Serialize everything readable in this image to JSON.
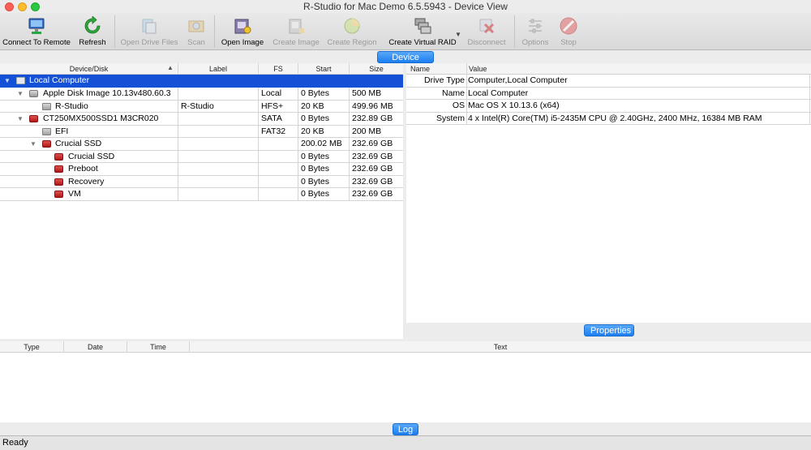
{
  "window": {
    "title": "R-Studio for Mac Demo 6.5.5943 - Device View"
  },
  "toolbar": {
    "connect_remote": "Connect To Remote",
    "refresh": "Refresh",
    "open_drive_files": "Open Drive Files",
    "scan": "Scan",
    "open_image": "Open Image",
    "create_image": "Create Image",
    "create_region": "Create Region",
    "create_virtual_raid": "Create Virtual RAID",
    "disconnect": "Disconnect",
    "options": "Options",
    "stop": "Stop"
  },
  "device_view": {
    "tab_label": "Device view",
    "columns": {
      "device": "Device/Disk",
      "label": "Label",
      "fs": "FS",
      "start": "Start",
      "size": "Size"
    },
    "rows": [
      {
        "name": "Local Computer",
        "label": "",
        "fs": "",
        "start": "",
        "size": ""
      },
      {
        "name": "Apple Disk Image 10.13v480.60.3",
        "label": "",
        "fs": "Local",
        "start": "0 Bytes",
        "size": "500 MB"
      },
      {
        "name": "R-Studio",
        "label": "R-Studio",
        "fs": "HFS+",
        "start": "20 KB",
        "size": "499.96 MB"
      },
      {
        "name": "CT250MX500SSD1 M3CR020",
        "label": "",
        "fs": "SATA",
        "start": "0 Bytes",
        "size": "232.89 GB"
      },
      {
        "name": "EFI",
        "label": "",
        "fs": "FAT32",
        "start": "20 KB",
        "size": "200 MB"
      },
      {
        "name": "Crucial SSD",
        "label": "",
        "fs": "",
        "start": "200.02 MB",
        "size": "232.69 GB"
      },
      {
        "name": "Crucial SSD",
        "label": "",
        "fs": "",
        "start": "0 Bytes",
        "size": "232.69 GB"
      },
      {
        "name": "Preboot",
        "label": "",
        "fs": "",
        "start": "0 Bytes",
        "size": "232.69 GB"
      },
      {
        "name": "Recovery",
        "label": "",
        "fs": "",
        "start": "0 Bytes",
        "size": "232.69 GB"
      },
      {
        "name": "VM",
        "label": "",
        "fs": "",
        "start": "0 Bytes",
        "size": "232.69 GB"
      }
    ]
  },
  "properties": {
    "tab_label": "Properties",
    "columns": {
      "name": "Name",
      "value": "Value"
    },
    "rows": [
      {
        "name": "Drive Type",
        "value": "Computer,Local Computer"
      },
      {
        "name": "Name",
        "value": "Local Computer"
      },
      {
        "name": "OS",
        "value": "Mac OS X 10.13.6 (x64)"
      },
      {
        "name": "System",
        "value": "4 x Intel(R) Core(TM) i5-2435M CPU @ 2.40GHz, 2400 MHz, 16384 MB RAM"
      }
    ]
  },
  "log": {
    "tab_label": "Log",
    "columns": {
      "type": "Type",
      "date": "Date",
      "time": "Time",
      "text": "Text"
    }
  },
  "status": {
    "text": "Ready"
  },
  "colors": {
    "selection": "#1451d6",
    "tab_accent": "#1c7ef0"
  }
}
